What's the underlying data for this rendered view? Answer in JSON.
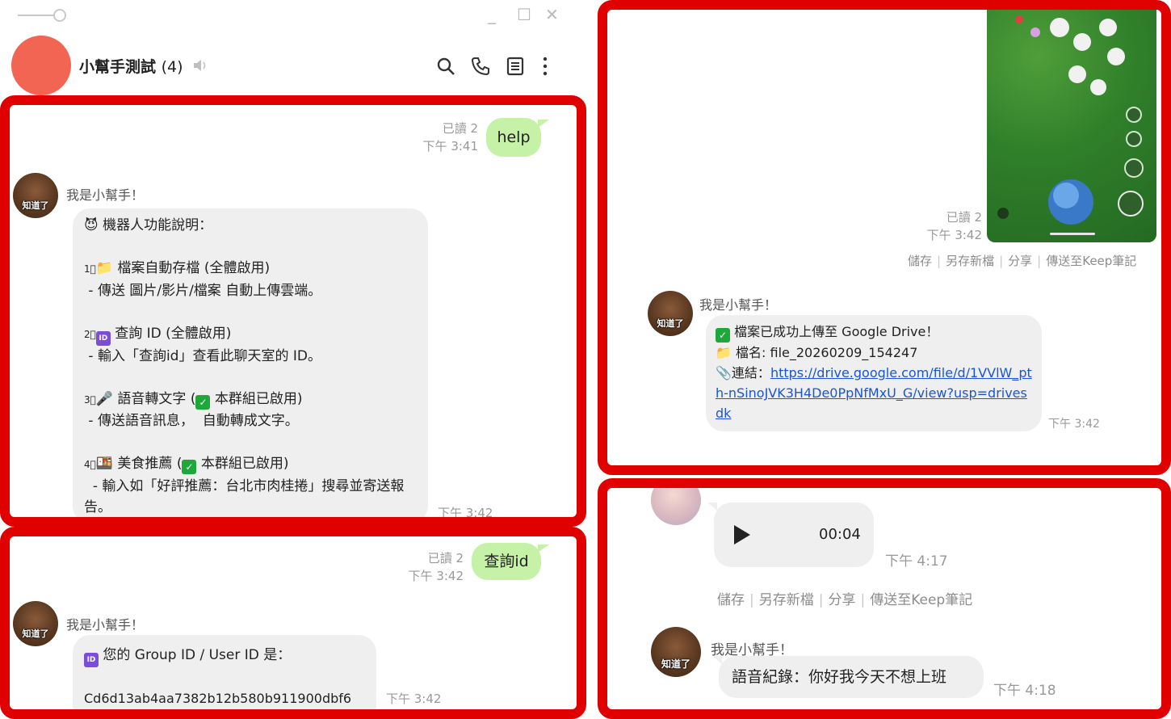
{
  "window": {
    "minimize": "_",
    "maximize": "☐",
    "close": "✕"
  },
  "header": {
    "title": "小幫手測試",
    "member_count": "(4)",
    "mute_icon": "speaker-icon",
    "icons": [
      "search-icon",
      "phone-icon",
      "notes-icon",
      "more-icon"
    ]
  },
  "panel1": {
    "out_msg": {
      "text": "help",
      "read": "已讀 2",
      "time": "下午 3:41"
    },
    "bot": {
      "sender": "我是小幫手！",
      "avatar_caption": "知道了",
      "intro": "機器人功能說明：",
      "f1_title": "檔案自動存檔 (全體啟用)",
      "f1_desc": " - 傳送 圖片/影片/檔案 自動上傳雲端。",
      "f2_title": "查詢 ID (全體啟用)",
      "f2_desc": " - 輸入「查詢id」查看此聊天室的 ID。",
      "f3_title_a": "語音轉文字 (",
      "f3_title_b": " 本群組已啟用)",
      "f3_desc": " - 傳送語音訊息，  自動轉成文字。",
      "f4_title_a": "美食推薦 (",
      "f4_title_b": " 本群組已啟用)",
      "f4_desc": "  - 輸入如「好評推薦：台北市肉桂捲」搜尋並寄送報告。",
      "time": "下午 3:42"
    }
  },
  "panel2": {
    "out_msg": {
      "text": "查詢id",
      "read": "已讀 2",
      "time": "下午 3:42"
    },
    "bot": {
      "sender": "我是小幫手！",
      "avatar_caption": "知道了",
      "line1": "您的 Group ID / User ID 是：",
      "line2": "Cd6d13ab4aa7382b12b580b911900dbf6",
      "time": "下午 3:42"
    }
  },
  "panel3": {
    "image_meta": {
      "read": "已讀 2",
      "time": "下午 3:42"
    },
    "image_actions": [
      "儲存",
      "另存新檔",
      "分享",
      "傳送至Keep筆記"
    ],
    "bot": {
      "sender": "我是小幫手！",
      "avatar_caption": "知道了",
      "line1": "檔案已成功上傳至 Google Drive！",
      "line2": "檔名: file_20260209_154247",
      "line3_label": "連結：",
      "link": "https://drive.google.com/file/d/1VVlW_pth-nSinoJVK3H4De0PpNfMxU_G/view?usp=drivesdk",
      "time": "下午 3:42"
    }
  },
  "panel4": {
    "audio": {
      "duration": "00:04",
      "time": "下午 4:17"
    },
    "audio_actions": [
      "儲存",
      "另存新檔",
      "分享",
      "傳送至Keep筆記"
    ],
    "bot": {
      "sender": "我是小幫手！",
      "avatar_caption": "知道了",
      "text": "語音紀錄：你好我今天不想上班",
      "time": "下午 4:18"
    }
  },
  "colors": {
    "frame": "#e00000",
    "out_bubble": "#c5f2a6",
    "in_bubble": "#efefef",
    "header_avatar": "#f26552",
    "link": "#1a55d6"
  }
}
